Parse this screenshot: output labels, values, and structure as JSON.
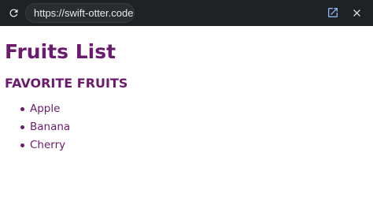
{
  "browser": {
    "url": "https://swift-otter.codecl"
  },
  "page": {
    "title": "Fruits List",
    "section_heading": "FAVORITE FRUITS",
    "fruits": [
      "Apple",
      "Banana",
      "Cherry"
    ]
  },
  "icons": {
    "reload": "reload-icon",
    "open_external": "open-external-icon",
    "close": "close-icon"
  },
  "colors": {
    "toolbar_bg": "#202124",
    "url_pill_bg": "#2b2c2f",
    "url_text": "#e8eaed",
    "open_external_accent": "#8ab4f8",
    "icon_light": "#e8eaed",
    "content_text": "#6a1b6e"
  }
}
